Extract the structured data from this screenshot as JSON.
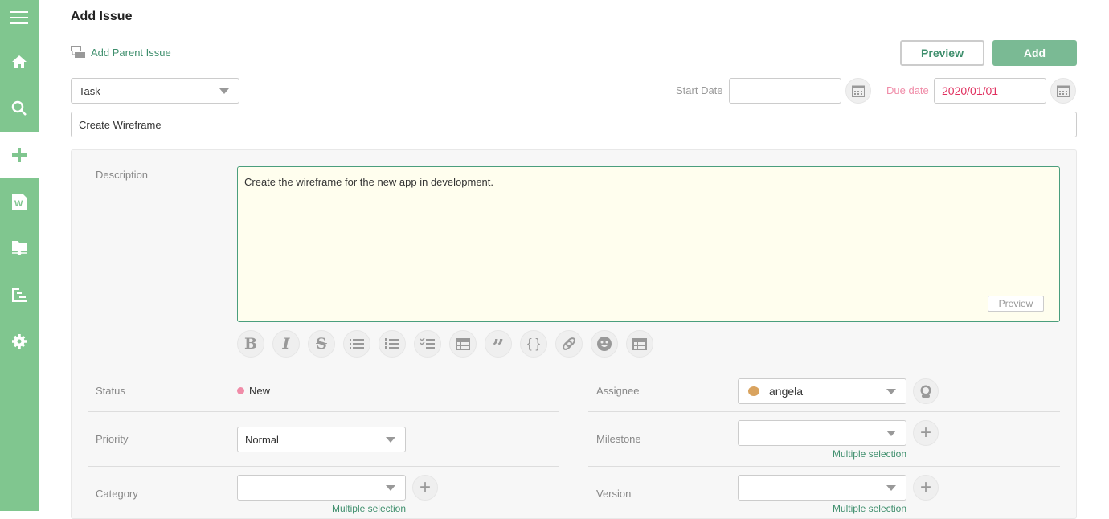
{
  "sidebar": {
    "items": [
      {
        "icon": "menu-icon"
      },
      {
        "icon": "home-icon"
      },
      {
        "icon": "search-icon"
      },
      {
        "icon": "plus-icon",
        "active": true
      },
      {
        "icon": "wiki-icon"
      },
      {
        "icon": "shared-folder-icon"
      },
      {
        "icon": "gantt-icon"
      },
      {
        "icon": "gear-icon"
      }
    ],
    "color": "#80c68f"
  },
  "header": {
    "title": "Add Issue",
    "add_parent": "Add Parent Issue",
    "preview": "Preview",
    "add": "Add"
  },
  "form": {
    "issue_type": "Task",
    "start_date_label": "Start Date",
    "start_date": "",
    "due_date_label": "Due date",
    "due_date": "2020/01/01",
    "subject": "Create Wireframe",
    "description_label": "Description",
    "description": "Create the wireframe for the new app in development.",
    "description_preview": "Preview",
    "toolbar": [
      "bold",
      "italic",
      "strikethrough",
      "bulleted-list",
      "numbered-list",
      "checklist",
      "table",
      "quote",
      "code",
      "link",
      "emoji",
      "table"
    ],
    "status_label": "Status",
    "status": "New",
    "status_color": "#f08ca8",
    "priority_label": "Priority",
    "priority": "Normal",
    "category_label": "Category",
    "category": "",
    "assignee_label": "Assignee",
    "assignee": "angela",
    "milestone_label": "Milestone",
    "milestone": "",
    "version_label": "Version",
    "version": "",
    "multiple_selection": "Multiple selection"
  },
  "colors": {
    "accent": "#3f8f6d",
    "add_button": "#7aba94",
    "due": "#e0305f"
  }
}
